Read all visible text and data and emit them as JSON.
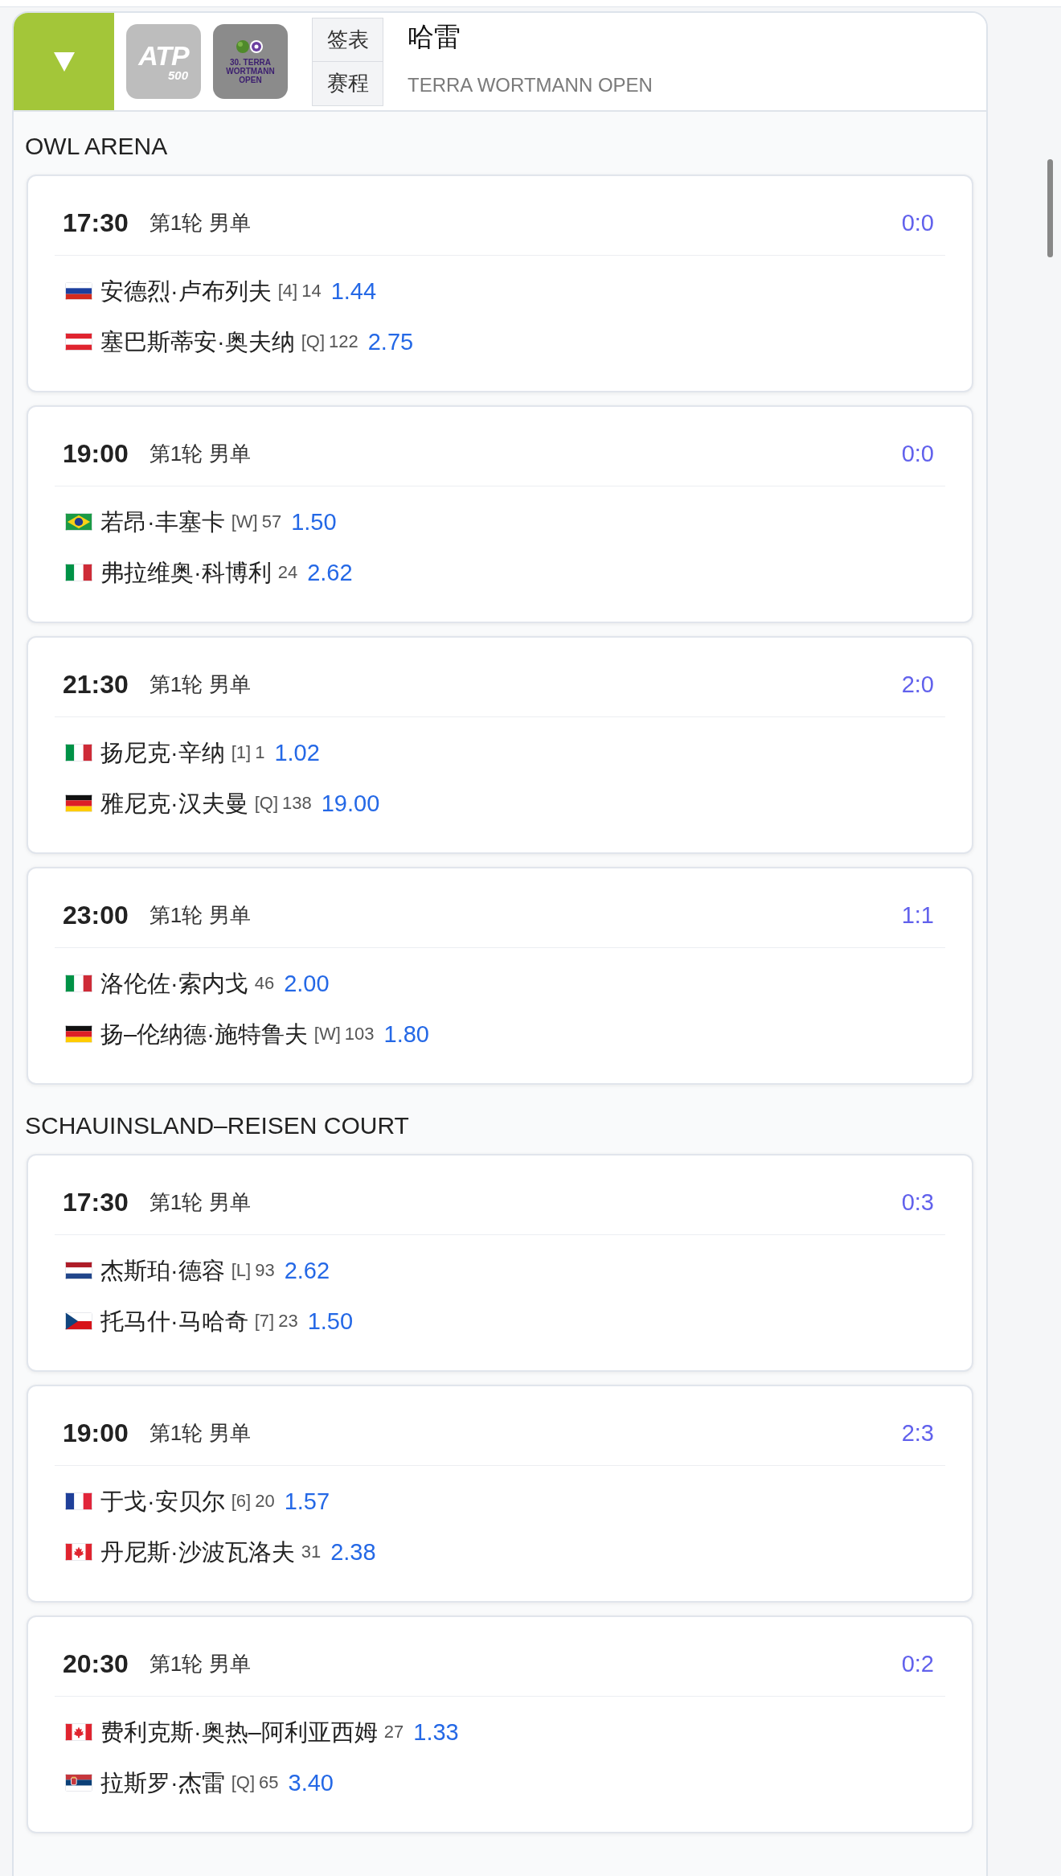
{
  "header": {
    "expanded": true,
    "logos": [
      {
        "kind": "atp",
        "text": "ATP",
        "sub": "500"
      },
      {
        "kind": "tournament",
        "caption": "30. TERRA WORTMANN OPEN"
      }
    ],
    "buttons": [
      "签表",
      "赛程"
    ],
    "title": "哈雷",
    "subtitle": "TERRA WORTMANN OPEN"
  },
  "courts": [
    {
      "name": "OWL ARENA",
      "matches": [
        {
          "time": "17:30",
          "round": "第1轮 男单",
          "score": "0:0",
          "players": [
            {
              "kind": "russia",
              "name": "安德烈·卢布列夫",
              "seed": "[4]",
              "rank": "14",
              "odds": "1.44"
            },
            {
              "kind": "austria",
              "name": "塞巴斯蒂安·奥夫纳",
              "seed": "[Q]",
              "rank": "122",
              "odds": "2.75"
            }
          ]
        },
        {
          "time": "19:00",
          "round": "第1轮 男单",
          "score": "0:0",
          "players": [
            {
              "kind": "brazil",
              "name": "若昂·丰塞卡",
              "seed": "[W]",
              "rank": "57",
              "odds": "1.50"
            },
            {
              "kind": "italy",
              "name": "弗拉维奥·科博利",
              "rank": "24",
              "odds": "2.62"
            }
          ]
        },
        {
          "time": "21:30",
          "round": "第1轮 男单",
          "score": "2:0",
          "players": [
            {
              "kind": "italy",
              "name": "扬尼克·辛纳",
              "seed": "[1]",
              "rank": "1",
              "odds": "1.02"
            },
            {
              "kind": "germany",
              "name": "雅尼克·汉夫曼",
              "seed": "[Q]",
              "rank": "138",
              "odds": "19.00"
            }
          ]
        },
        {
          "time": "23:00",
          "round": "第1轮 男单",
          "score": "1:1",
          "players": [
            {
              "kind": "italy",
              "name": "洛伦佐·索内戈",
              "rank": "46",
              "odds": "2.00"
            },
            {
              "kind": "germany",
              "name": "扬–伦纳德·施特鲁夫",
              "seed": "[W]",
              "rank": "103",
              "odds": "1.80"
            }
          ]
        }
      ]
    },
    {
      "name": "SCHAUINSLAND–REISEN COURT",
      "matches": [
        {
          "time": "17:30",
          "round": "第1轮 男单",
          "score": "0:3",
          "players": [
            {
              "kind": "netherlands",
              "name": "杰斯珀·德容",
              "seed": "[L]",
              "rank": "93",
              "odds": "2.62"
            },
            {
              "kind": "czechia",
              "name": "托马什·马哈奇",
              "seed": "[7]",
              "rank": "23",
              "odds": "1.50"
            }
          ]
        },
        {
          "time": "19:00",
          "round": "第1轮 男单",
          "score": "2:3",
          "players": [
            {
              "kind": "france",
              "name": "于戈·安贝尔",
              "seed": "[6]",
              "rank": "20",
              "odds": "1.57"
            },
            {
              "kind": "canada",
              "name": "丹尼斯·沙波瓦洛夫",
              "rank": "31",
              "odds": "2.38"
            }
          ]
        },
        {
          "time": "20:30",
          "round": "第1轮 男单",
          "score": "0:2",
          "players": [
            {
              "kind": "canada",
              "name": "费利克斯·奥热–阿利亚西姆",
              "rank": "27",
              "odds": "1.33"
            },
            {
              "kind": "serbia",
              "name": "拉斯罗·杰雷",
              "seed": "[Q]",
              "rank": "65",
              "odds": "3.40"
            }
          ]
        }
      ]
    }
  ]
}
